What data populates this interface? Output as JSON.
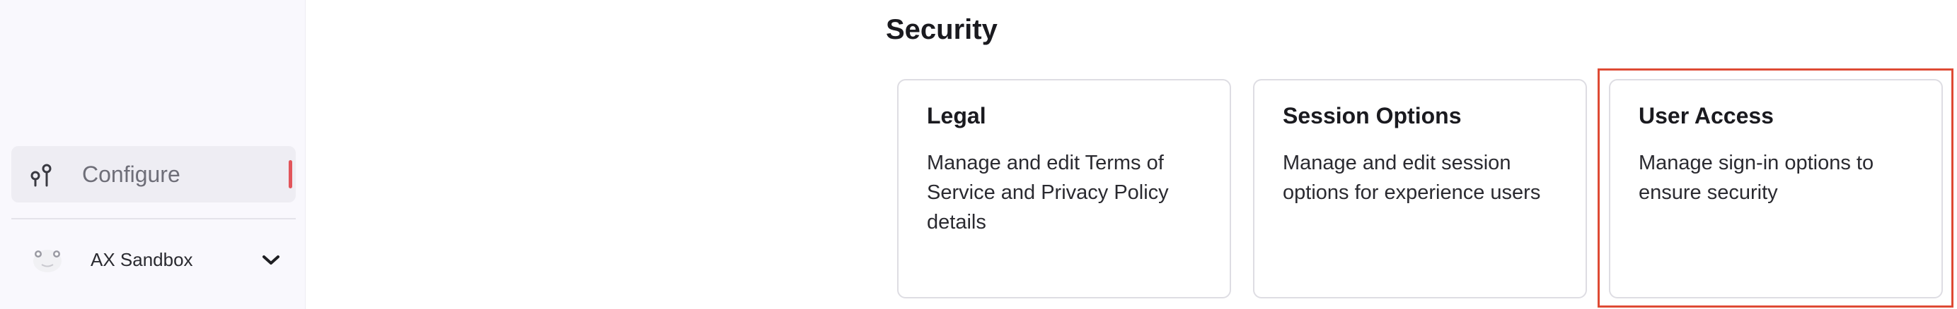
{
  "sidebar": {
    "configure": {
      "label": "Configure",
      "icon": "sliders-icon",
      "marker_color": "#e2555b"
    },
    "workspace": {
      "name": "AX Sandbox",
      "icon": "avatar",
      "chevron": "chevron-down-icon"
    }
  },
  "main": {
    "section_title": "Security",
    "cards": [
      {
        "title": "Legal",
        "description": "Manage and edit Terms of Service and Privacy Policy details"
      },
      {
        "title": "Session Options",
        "description": "Manage and edit session options for experience users"
      },
      {
        "title": "User Access",
        "description": "Manage sign-in options to ensure security"
      }
    ],
    "highlight_color": "#de4a34"
  }
}
